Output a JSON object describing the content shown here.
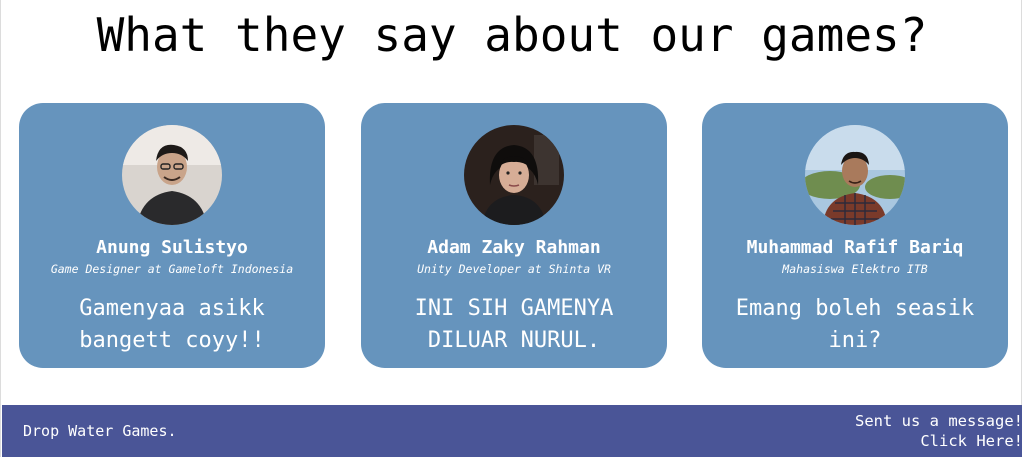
{
  "header": {
    "title": "What they say about our games?"
  },
  "testimonials": [
    {
      "name": "Anung Sulistyo",
      "role": "Game Designer at Gameloft Indonesia",
      "quote": "Gamenyaa asikk bangett coyy!!",
      "avatar_icon": "person-photo-icon"
    },
    {
      "name": "Adam Zaky Rahman",
      "role": "Unity Developer at Shinta VR",
      "quote": "INI SIH GAMENYA DILUAR NURUL.",
      "avatar_icon": "person-photo-icon"
    },
    {
      "name": "Muhammad Rafif Bariq",
      "role": "Mahasiswa Elektro ITB",
      "quote": "Emang boleh seasik ini?",
      "avatar_icon": "person-photo-icon"
    }
  ],
  "footer": {
    "brand": "Drop Water Games.",
    "message_line1": "Sent us a message!",
    "message_line2": "Click Here!"
  },
  "colors": {
    "card_bg": "#6694bd",
    "footer_bg": "#4a5597",
    "text_light": "#ffffff"
  }
}
